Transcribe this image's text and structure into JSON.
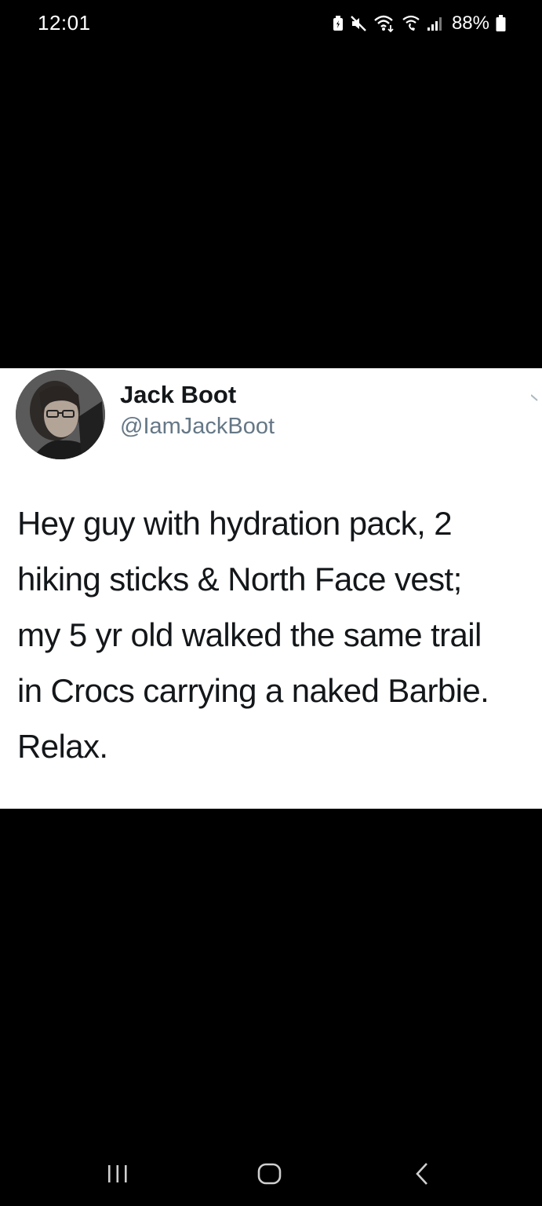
{
  "status_bar": {
    "time": "12:01",
    "battery_percent": "88%",
    "icons": [
      "battery-saver-icon",
      "mute-icon",
      "wifi-icon",
      "wifi-calling-icon",
      "signal-icon",
      "battery-icon"
    ]
  },
  "tweet": {
    "author_name": "Jack Boot",
    "author_handle": "@IamJackBoot",
    "text": "Hey guy with hydration pack, 2\nhiking sticks & North Face vest;\nmy 5 yr old walked the same trail\nin Crocs carrying a naked Barbie.\nRelax."
  },
  "nav_bar": {
    "buttons": [
      "recents-button",
      "home-button",
      "back-button"
    ]
  },
  "colors": {
    "background": "#000000",
    "card": "#ffffff",
    "text": "#14171a",
    "handle": "#657786"
  }
}
